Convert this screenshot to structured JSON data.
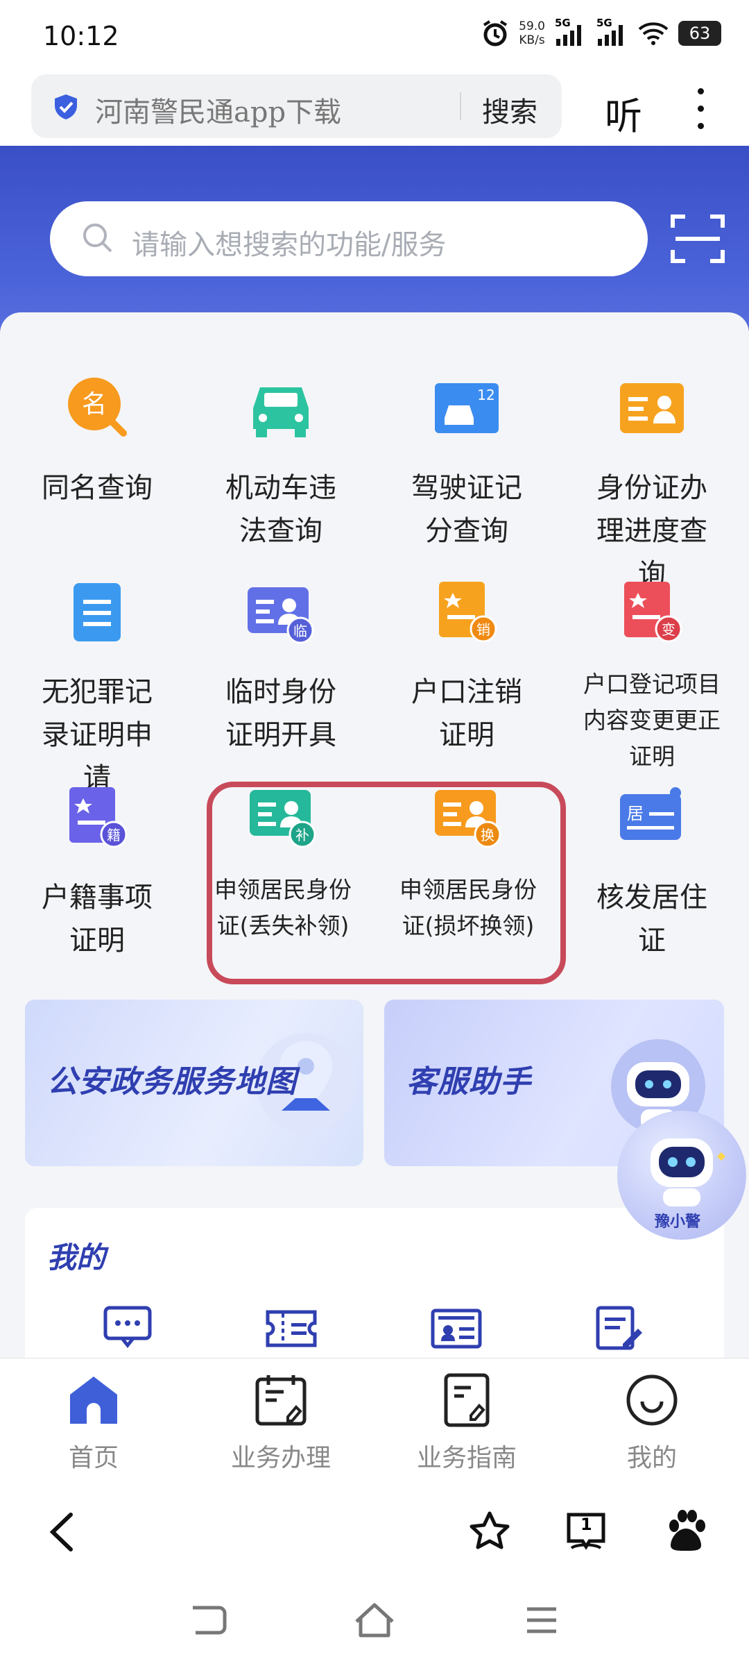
{
  "status": {
    "time": "10:12",
    "net_speed": "59.0",
    "net_unit": "KB/s",
    "sim1": "5G",
    "sim2": "5G",
    "battery": "63"
  },
  "browser": {
    "url_text": "河南警民通app下载",
    "search_label": "搜索",
    "listen_label": "听"
  },
  "hero": {
    "search_placeholder": "请输入想搜索的功能/服务"
  },
  "services": [
    {
      "label": "同名查询",
      "icon": "name-search-icon",
      "color": "#f79a1e"
    },
    {
      "label": "机动车违法查询",
      "icon": "car-icon",
      "color": "#2cc4a0"
    },
    {
      "label": "驾驶证记分查询",
      "icon": "license-score-icon",
      "color": "#3b8cf0"
    },
    {
      "label": "身份证办理进度查询",
      "icon": "id-card-icon",
      "color": "#f7a21e"
    },
    {
      "label": "无犯罪记录证明申请",
      "icon": "document-icon",
      "color": "#3b9af0"
    },
    {
      "label": "临时身份证明开具",
      "icon": "temp-id-icon",
      "color": "#6270e8"
    },
    {
      "label": "户口注销证明",
      "icon": "hukou-cancel-icon",
      "color": "#f7a21e"
    },
    {
      "label": "户口登记项目内容变更更正证明",
      "icon": "hukou-change-icon",
      "color": "#ec4f5a"
    },
    {
      "label": "户籍事项证明",
      "icon": "household-icon",
      "color": "#6a62e8"
    },
    {
      "label": "申领居民身份证(丢失补领)",
      "icon": "id-reissue-icon",
      "color": "#25b89a"
    },
    {
      "label": "申领居民身份证(损坏换领)",
      "icon": "id-replace-icon",
      "color": "#f79a1e"
    },
    {
      "label": "核发居住证",
      "icon": "residence-permit-icon",
      "color": "#4a7ae8"
    }
  ],
  "badges": {
    "temp": "临",
    "cancel": "销",
    "change": "变",
    "household": "籍",
    "reissue": "补",
    "replace": "换",
    "license_num": "12",
    "name_char": "名",
    "residence_char": "居"
  },
  "banners": {
    "map": "公安政务服务地图",
    "assistant": "客服助手"
  },
  "mine": {
    "title": "我的"
  },
  "bot": {
    "name": "豫小警"
  },
  "tabs": [
    {
      "label": "首页",
      "icon": "home-icon",
      "active": true
    },
    {
      "label": "业务办理",
      "icon": "calendar-icon",
      "active": false
    },
    {
      "label": "业务指南",
      "icon": "guide-icon",
      "active": false
    },
    {
      "label": "我的",
      "icon": "profile-icon",
      "active": false
    }
  ],
  "browser_nav": {
    "tab_count": "1"
  }
}
